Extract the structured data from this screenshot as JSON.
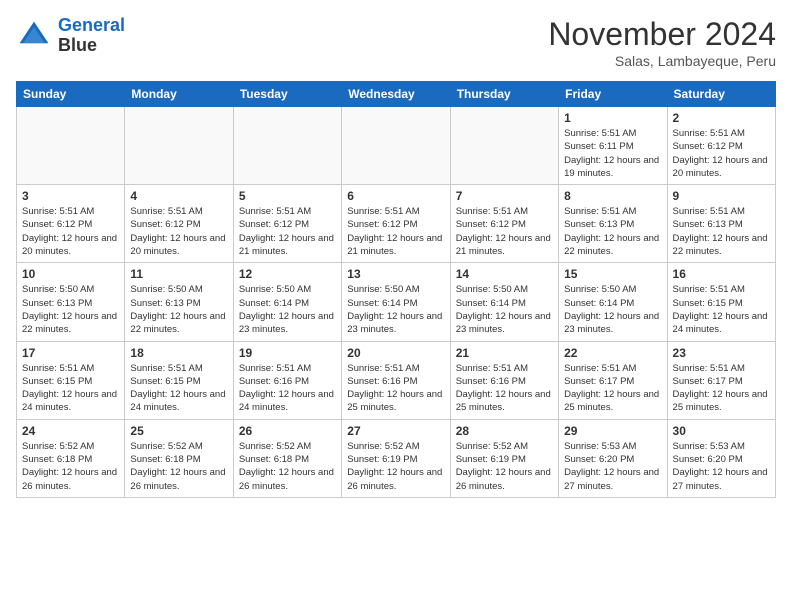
{
  "header": {
    "logo_line1": "General",
    "logo_line2": "Blue",
    "month": "November 2024",
    "location": "Salas, Lambayeque, Peru"
  },
  "weekdays": [
    "Sunday",
    "Monday",
    "Tuesday",
    "Wednesday",
    "Thursday",
    "Friday",
    "Saturday"
  ],
  "weeks": [
    [
      {
        "day": "",
        "info": ""
      },
      {
        "day": "",
        "info": ""
      },
      {
        "day": "",
        "info": ""
      },
      {
        "day": "",
        "info": ""
      },
      {
        "day": "",
        "info": ""
      },
      {
        "day": "1",
        "info": "Sunrise: 5:51 AM\nSunset: 6:11 PM\nDaylight: 12 hours and 19 minutes."
      },
      {
        "day": "2",
        "info": "Sunrise: 5:51 AM\nSunset: 6:12 PM\nDaylight: 12 hours and 20 minutes."
      }
    ],
    [
      {
        "day": "3",
        "info": "Sunrise: 5:51 AM\nSunset: 6:12 PM\nDaylight: 12 hours and 20 minutes."
      },
      {
        "day": "4",
        "info": "Sunrise: 5:51 AM\nSunset: 6:12 PM\nDaylight: 12 hours and 20 minutes."
      },
      {
        "day": "5",
        "info": "Sunrise: 5:51 AM\nSunset: 6:12 PM\nDaylight: 12 hours and 21 minutes."
      },
      {
        "day": "6",
        "info": "Sunrise: 5:51 AM\nSunset: 6:12 PM\nDaylight: 12 hours and 21 minutes."
      },
      {
        "day": "7",
        "info": "Sunrise: 5:51 AM\nSunset: 6:12 PM\nDaylight: 12 hours and 21 minutes."
      },
      {
        "day": "8",
        "info": "Sunrise: 5:51 AM\nSunset: 6:13 PM\nDaylight: 12 hours and 22 minutes."
      },
      {
        "day": "9",
        "info": "Sunrise: 5:51 AM\nSunset: 6:13 PM\nDaylight: 12 hours and 22 minutes."
      }
    ],
    [
      {
        "day": "10",
        "info": "Sunrise: 5:50 AM\nSunset: 6:13 PM\nDaylight: 12 hours and 22 minutes."
      },
      {
        "day": "11",
        "info": "Sunrise: 5:50 AM\nSunset: 6:13 PM\nDaylight: 12 hours and 22 minutes."
      },
      {
        "day": "12",
        "info": "Sunrise: 5:50 AM\nSunset: 6:14 PM\nDaylight: 12 hours and 23 minutes."
      },
      {
        "day": "13",
        "info": "Sunrise: 5:50 AM\nSunset: 6:14 PM\nDaylight: 12 hours and 23 minutes."
      },
      {
        "day": "14",
        "info": "Sunrise: 5:50 AM\nSunset: 6:14 PM\nDaylight: 12 hours and 23 minutes."
      },
      {
        "day": "15",
        "info": "Sunrise: 5:50 AM\nSunset: 6:14 PM\nDaylight: 12 hours and 23 minutes."
      },
      {
        "day": "16",
        "info": "Sunrise: 5:51 AM\nSunset: 6:15 PM\nDaylight: 12 hours and 24 minutes."
      }
    ],
    [
      {
        "day": "17",
        "info": "Sunrise: 5:51 AM\nSunset: 6:15 PM\nDaylight: 12 hours and 24 minutes."
      },
      {
        "day": "18",
        "info": "Sunrise: 5:51 AM\nSunset: 6:15 PM\nDaylight: 12 hours and 24 minutes."
      },
      {
        "day": "19",
        "info": "Sunrise: 5:51 AM\nSunset: 6:16 PM\nDaylight: 12 hours and 24 minutes."
      },
      {
        "day": "20",
        "info": "Sunrise: 5:51 AM\nSunset: 6:16 PM\nDaylight: 12 hours and 25 minutes."
      },
      {
        "day": "21",
        "info": "Sunrise: 5:51 AM\nSunset: 6:16 PM\nDaylight: 12 hours and 25 minutes."
      },
      {
        "day": "22",
        "info": "Sunrise: 5:51 AM\nSunset: 6:17 PM\nDaylight: 12 hours and 25 minutes."
      },
      {
        "day": "23",
        "info": "Sunrise: 5:51 AM\nSunset: 6:17 PM\nDaylight: 12 hours and 25 minutes."
      }
    ],
    [
      {
        "day": "24",
        "info": "Sunrise: 5:52 AM\nSunset: 6:18 PM\nDaylight: 12 hours and 26 minutes."
      },
      {
        "day": "25",
        "info": "Sunrise: 5:52 AM\nSunset: 6:18 PM\nDaylight: 12 hours and 26 minutes."
      },
      {
        "day": "26",
        "info": "Sunrise: 5:52 AM\nSunset: 6:18 PM\nDaylight: 12 hours and 26 minutes."
      },
      {
        "day": "27",
        "info": "Sunrise: 5:52 AM\nSunset: 6:19 PM\nDaylight: 12 hours and 26 minutes."
      },
      {
        "day": "28",
        "info": "Sunrise: 5:52 AM\nSunset: 6:19 PM\nDaylight: 12 hours and 26 minutes."
      },
      {
        "day": "29",
        "info": "Sunrise: 5:53 AM\nSunset: 6:20 PM\nDaylight: 12 hours and 27 minutes."
      },
      {
        "day": "30",
        "info": "Sunrise: 5:53 AM\nSunset: 6:20 PM\nDaylight: 12 hours and 27 minutes."
      }
    ]
  ]
}
